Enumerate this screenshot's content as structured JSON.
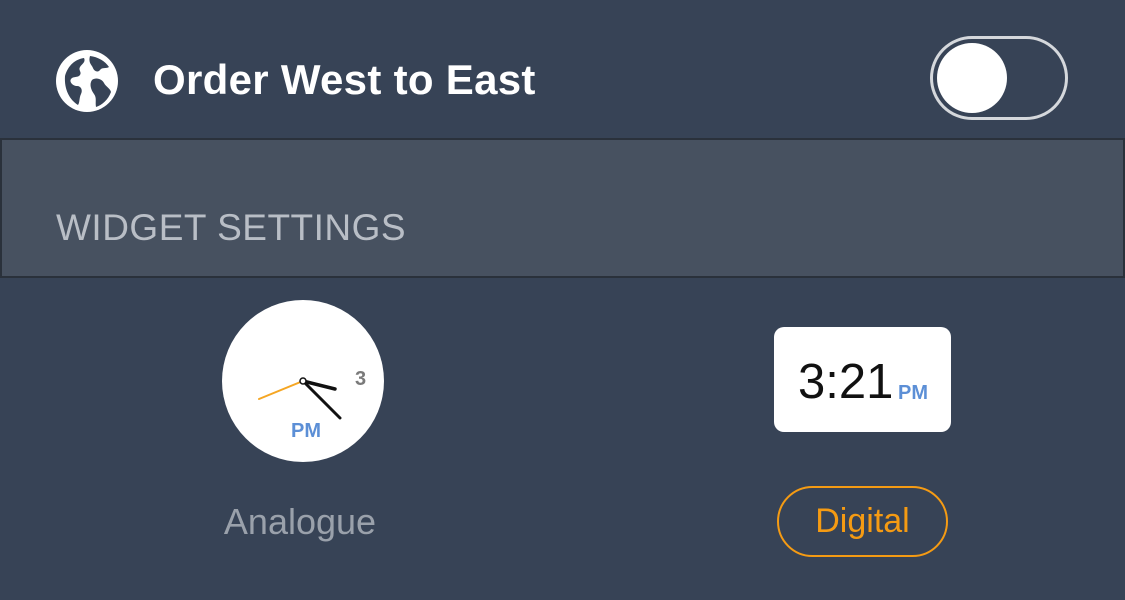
{
  "header": {
    "icon": "globe-icon",
    "title": "Order West to East",
    "toggle": {
      "state": "off"
    }
  },
  "widget_settings": {
    "label": "WIDGET SETTINGS"
  },
  "widgets": {
    "analogue": {
      "clock_number": "3",
      "ampm": "PM",
      "label": "Analogue",
      "selected": false
    },
    "digital": {
      "time": "3:21",
      "ampm": "PM",
      "label": "Digital",
      "selected": true
    }
  },
  "colors": {
    "background": "#374356",
    "section_background": "#475160",
    "accent": "#f59b13",
    "ampm_blue": "#5c8fd6",
    "second_hand": "#f5a623"
  }
}
